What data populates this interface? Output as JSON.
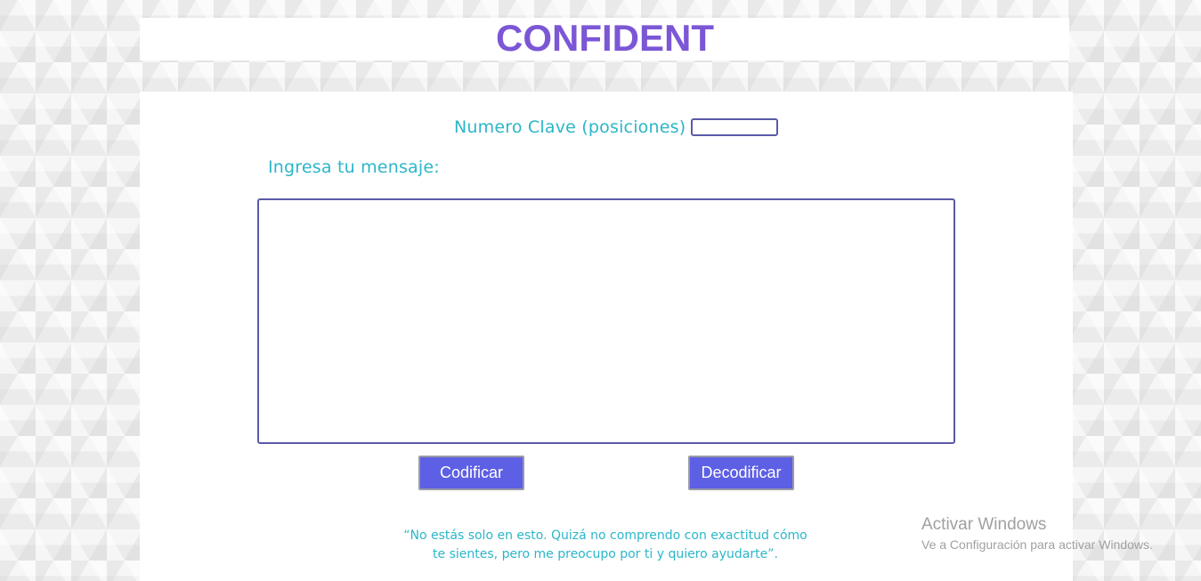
{
  "app": {
    "title": "CONFIDENT"
  },
  "form": {
    "key_label": "Numero Clave (posiciones)",
    "key_value": "",
    "message_label": "Ingresa tu mensaje:",
    "message_value": ""
  },
  "actions": {
    "encode_label": "Codificar",
    "decode_label": "Decodificar"
  },
  "quote": {
    "line1": "“No estás solo en esto. Quizá no comprendo con exactitud cómo",
    "line2": "te sientes, pero me preocupo por ti y quiero ayudarte”."
  },
  "windows_activation": {
    "title": "Activar Windows",
    "subtitle": "Ve a Configuración para activar Windows."
  },
  "colors": {
    "title": "#7b57d6",
    "label": "#2bb6c9",
    "button": "#5d5fe4",
    "field_border": "#5a5aa8"
  }
}
